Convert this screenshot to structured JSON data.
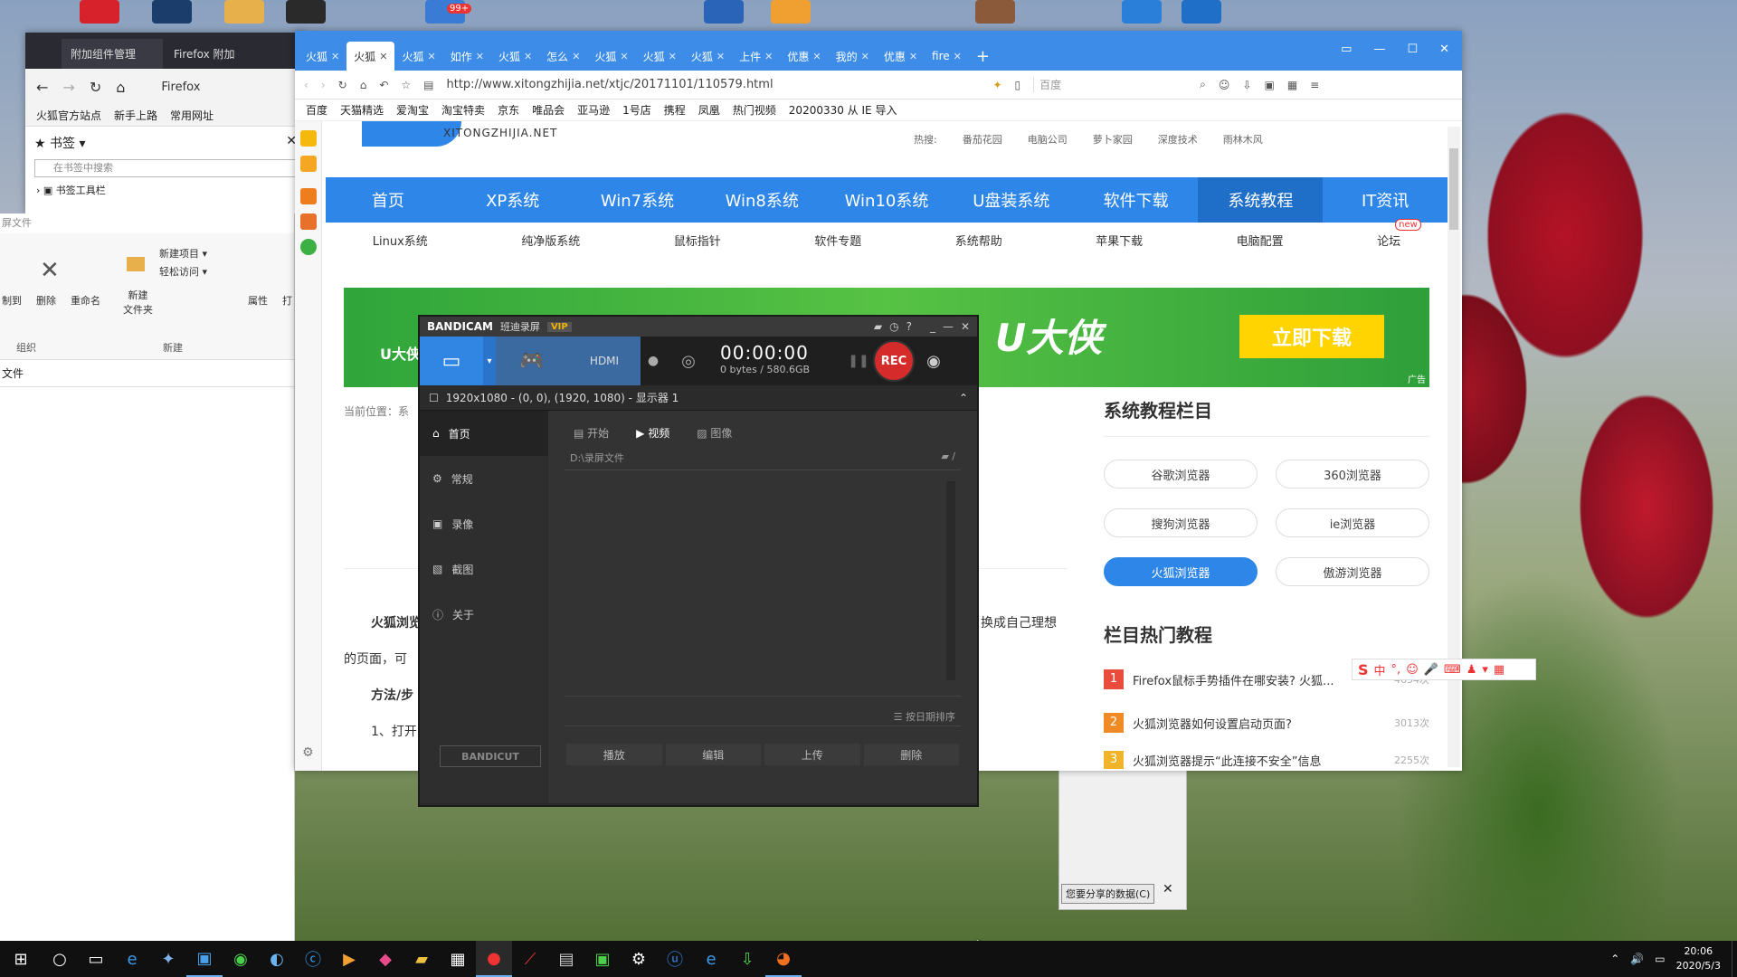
{
  "desktop": {
    "badge": "99+"
  },
  "firefox_addons": {
    "tab1": "附加组件管理",
    "tab2": "Firefox 附加",
    "brand": "Firefox",
    "bookmarks": [
      "火狐官方站点",
      "新手上路",
      "常用网址"
    ],
    "panel_title": "书签",
    "search_placeholder": "在书签中搜索",
    "toolbar_item": "书签工具栏"
  },
  "explorer": {
    "title": "屏文件",
    "cmds": {
      "copy": "制到",
      "delete": "删除",
      "rename": "重命名",
      "new_folder": "新建\n文件夹",
      "new_item": "新建项目 ▾",
      "easy_access": "轻松访问 ▾",
      "props": "属性",
      "open": "打"
    },
    "groups": [
      "组织",
      "新建"
    ],
    "col": "文件",
    "dialog_btn": "您要分享的数据(C)"
  },
  "browser": {
    "tabs": [
      {
        "label": "火狐"
      },
      {
        "label": "火狐",
        "active": true
      },
      {
        "label": "火狐"
      },
      {
        "label": "如作"
      },
      {
        "label": "火狐"
      },
      {
        "label": "怎么"
      },
      {
        "label": "火狐"
      },
      {
        "label": "火狐"
      },
      {
        "label": "火狐"
      },
      {
        "label": "上件"
      },
      {
        "label": "优惠"
      },
      {
        "label": "我的"
      },
      {
        "label": "优惠"
      },
      {
        "label": "fire"
      }
    ],
    "url": "http://www.xitongzhijia.net/xtjc/20171101/110579.html",
    "search_engine": "百度",
    "bookmarks": [
      "百度",
      "天猫精选",
      "爱淘宝",
      "淘宝特卖",
      "京东",
      "唯品会",
      "亚马逊",
      "1号店",
      "携程",
      "凤凰",
      "热门视频",
      "20200330 从 IE 导入"
    ]
  },
  "site": {
    "logo": "XITONGZHIJIA.NET",
    "hot_label": "热搜:",
    "hot_links": [
      "番茄花园",
      "电脑公司",
      "萝卜家园",
      "深度技术",
      "雨林木风"
    ],
    "nav": [
      "首页",
      "XP系统",
      "Win7系统",
      "Win8系统",
      "Win10系统",
      "U盘装系统",
      "软件下载",
      "系统教程",
      "IT资讯"
    ],
    "subnav": [
      "Linux系统",
      "纯净版系统",
      "鼠标指针",
      "软件专题",
      "系统帮助",
      "苹果下载",
      "电脑配置",
      "论坛"
    ],
    "new_tag": "new",
    "banner_left": "U大侠",
    "banner_big": "U大侠",
    "banner_btn": "立即下载",
    "ad": "广告",
    "breadcrumb": "当前位置：系",
    "body": [
      "火狐浏览",
      "的页面，可",
      "方法/步",
      "1、打开"
    ],
    "body_right": "换成自己理想",
    "side_title": "系统教程栏目",
    "pills": [
      "谷歌浏览器",
      "360浏览器",
      "搜狗浏览器",
      "ie浏览器",
      "火狐浏览器",
      "傲游浏览器"
    ],
    "hot_title": "栏目热门教程",
    "hot": [
      {
        "n": "1",
        "t": "Firefox鼠标手势插件在哪安装? 火狐...",
        "c": "4654次",
        "color": "#e94b3c"
      },
      {
        "n": "2",
        "t": "火狐浏览器如何设置启动页面?",
        "c": "3013次",
        "color": "#f08a24"
      },
      {
        "n": "3",
        "t": "火狐浏览器提示“此连接不安全”信息",
        "c": "2255次",
        "color": "#f0b429"
      }
    ]
  },
  "bandicam": {
    "brand": "BANDICAM",
    "sub": "班迪录屏",
    "vip": "VIP",
    "timer": "00:00:00",
    "size": "0 bytes / 580.6GB",
    "rec": "REC",
    "area": "1920x1080 - (0, 0), (1920, 1080) - 显示器 1",
    "menu": [
      "首页",
      "常规",
      "录像",
      "截图",
      "关于"
    ],
    "tabs": [
      "开始",
      "视频",
      "图像"
    ],
    "path": "D:\\录屏文件",
    "sort": "按日期排序",
    "actions": [
      "播放",
      "编辑",
      "上传",
      "删除"
    ],
    "bandicut": "BANDICUT"
  },
  "ime": "中",
  "clock": {
    "time": "20:06",
    "date": "2020/5/3"
  }
}
